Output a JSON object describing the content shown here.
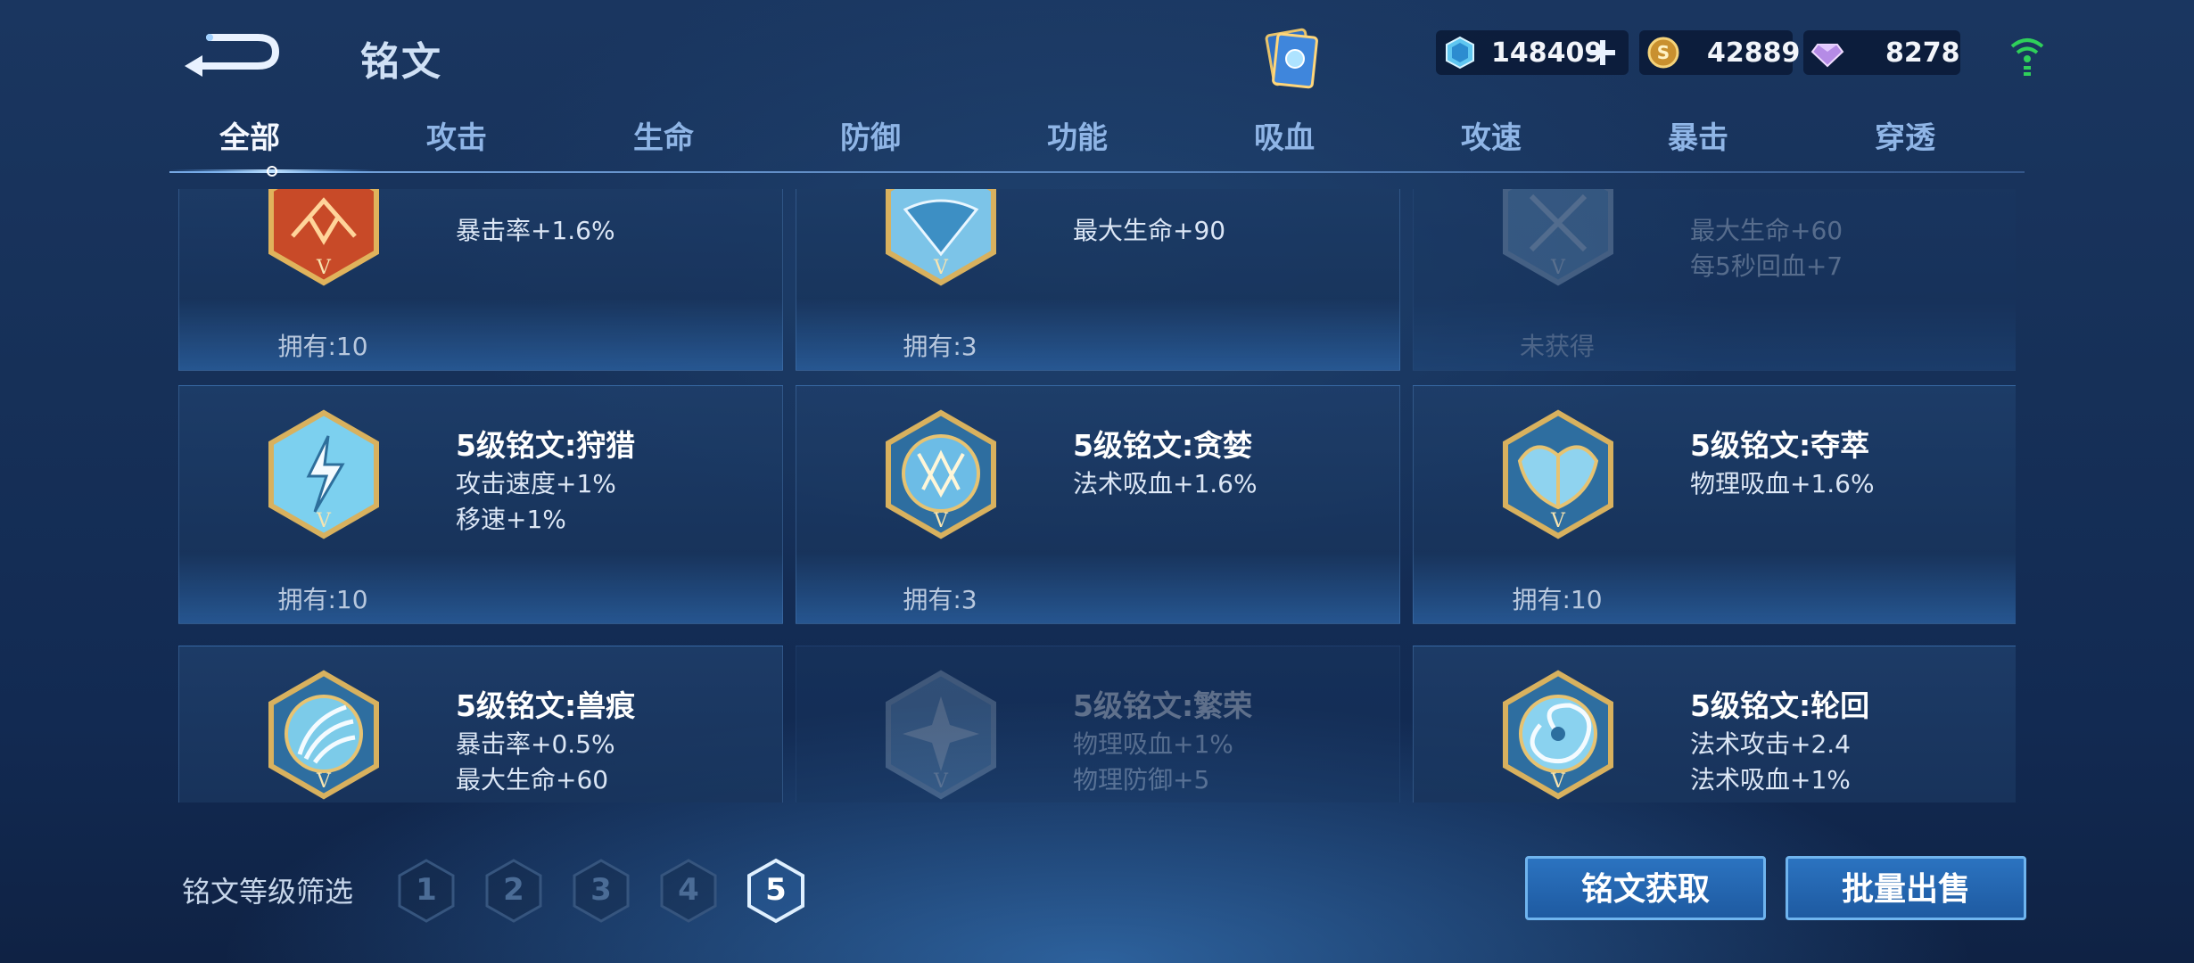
{
  "header": {
    "title": "铭文",
    "back_icon": "back-arrow-icon",
    "book_icon": "rune-book-icon"
  },
  "currencies": {
    "coupon": {
      "icon": "coupon-crystal-icon",
      "value": "148409",
      "plus_icon": "plus-icon"
    },
    "gold": {
      "icon": "gold-coin-icon",
      "value": "42889"
    },
    "gem": {
      "icon": "gem-icon",
      "value": "8278"
    }
  },
  "status": {
    "signal_icon": "wifi-signal-icon"
  },
  "tabs": [
    "全部",
    "攻击",
    "生命",
    "防御",
    "功能",
    "吸血",
    "攻速",
    "暴击",
    "穿透"
  ],
  "active_tab": 0,
  "runes": [
    {
      "name": "",
      "attrs": [
        "暴击率+1.6%"
      ],
      "own": "拥有:10",
      "color": "#d9522c",
      "locked": false
    },
    {
      "name": "",
      "attrs": [
        "最大生命+90"
      ],
      "own": "拥有:3",
      "color": "#7cc4e8",
      "locked": false
    },
    {
      "name": "",
      "attrs": [
        "最大生命+60",
        "每5秒回血+7"
      ],
      "own": "未获得",
      "color": "#6f9cc4",
      "locked": true
    },
    {
      "name": "5级铭文:狩猎",
      "attrs": [
        "攻击速度+1%",
        "移速+1%"
      ],
      "own": "拥有:10",
      "color": "#7cd0ef",
      "locked": false
    },
    {
      "name": "5级铭文:贪婪",
      "attrs": [
        "法术吸血+1.6%"
      ],
      "own": "拥有:3",
      "color": "#6cbce6",
      "locked": false
    },
    {
      "name": "5级铭文:夺萃",
      "attrs": [
        "物理吸血+1.6%"
      ],
      "own": "拥有:10",
      "color": "#8fd3ef",
      "locked": false
    },
    {
      "name": "5级铭文:兽痕",
      "attrs": [
        "暴击率+0.5%",
        "最大生命+60"
      ],
      "own": "",
      "color": "#7ccbe9",
      "locked": false
    },
    {
      "name": "5级铭文:繁荣",
      "attrs": [
        "物理吸血+1%",
        "物理防御+5"
      ],
      "own": "",
      "color": "#6f9cc4",
      "locked": true
    },
    {
      "name": "5级铭文:轮回",
      "attrs": [
        "法术攻击+2.4",
        "法术吸血+1%"
      ],
      "own": "",
      "color": "#8ad2ef",
      "locked": false
    }
  ],
  "filter": {
    "label": "铭文等级筛选",
    "levels": [
      "1",
      "2",
      "3",
      "4",
      "5"
    ],
    "active": "5"
  },
  "actions": {
    "get_label": "铭文获取",
    "sell_label": "批量出售"
  },
  "colors": {
    "accent": "#2b73c0",
    "tab_active": "#f4f8ff",
    "tab_inactive": "#8fb5e6"
  }
}
